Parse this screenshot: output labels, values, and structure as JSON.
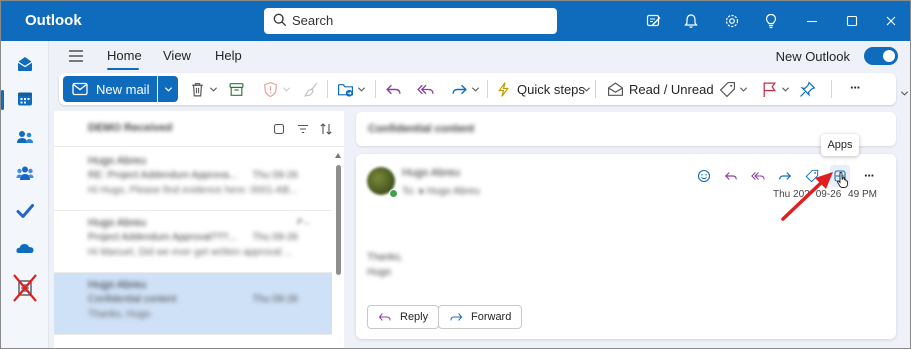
{
  "window": {
    "title": "Outlook"
  },
  "search": {
    "placeholder": "Search"
  },
  "titlebar_icons": [
    "compose-icon",
    "bell-icon",
    "gear-icon",
    "lightbulb-icon",
    "minimize-icon",
    "maximize-icon",
    "close-icon"
  ],
  "menu": {
    "tabs": [
      "Home",
      "View",
      "Help"
    ],
    "active_tab": "Home",
    "new_outlook_label": "New Outlook",
    "new_outlook_on": true
  },
  "ribbon": {
    "new_mail": "New mail",
    "quick_steps": "Quick steps",
    "read_unread": "Read / Unread",
    "more": "···"
  },
  "rail": [
    "mail-icon",
    "calendar-icon",
    "people-icon",
    "groups-icon",
    "todo-icon",
    "onedrive-icon",
    "office-app-icon"
  ],
  "message_list": {
    "folder_title": "DEMO Received",
    "items": [
      {
        "sender": "Hugo Abreu",
        "subject": "RE: Project Addendum Approva...",
        "date": "Thu 09-26",
        "preview": "Hi Hugo, Please find evidence here: 0001-AB...",
        "selected": false
      },
      {
        "sender": "Hugo Abreu",
        "subject": "Project Addendum Approval???...",
        "date": "Thu 09-26",
        "preview": "Hi Manuel, Did we ever get written approval ...",
        "selected": false,
        "flag": "P←"
      },
      {
        "sender": "Hugo Abreu",
        "subject": "Confidential content",
        "date": "Thu 09-26",
        "preview": "Thanks, Hugo",
        "selected": true
      }
    ]
  },
  "reading_pane": {
    "subject": "Confidential content",
    "sender": "Hugo Abreu",
    "to": "To: ● Hugo Abreu",
    "date": "Thu 202   09-26   49 PM",
    "body_line1": "Thanks,",
    "body_line2": "Hugo",
    "reply": "Reply",
    "forward": "Forward",
    "more": "···"
  },
  "tooltip": {
    "text": "Apps"
  },
  "colors": {
    "brand": "#0f6cbd",
    "selected": "#cfe1f7",
    "annotation": "#e02020"
  }
}
